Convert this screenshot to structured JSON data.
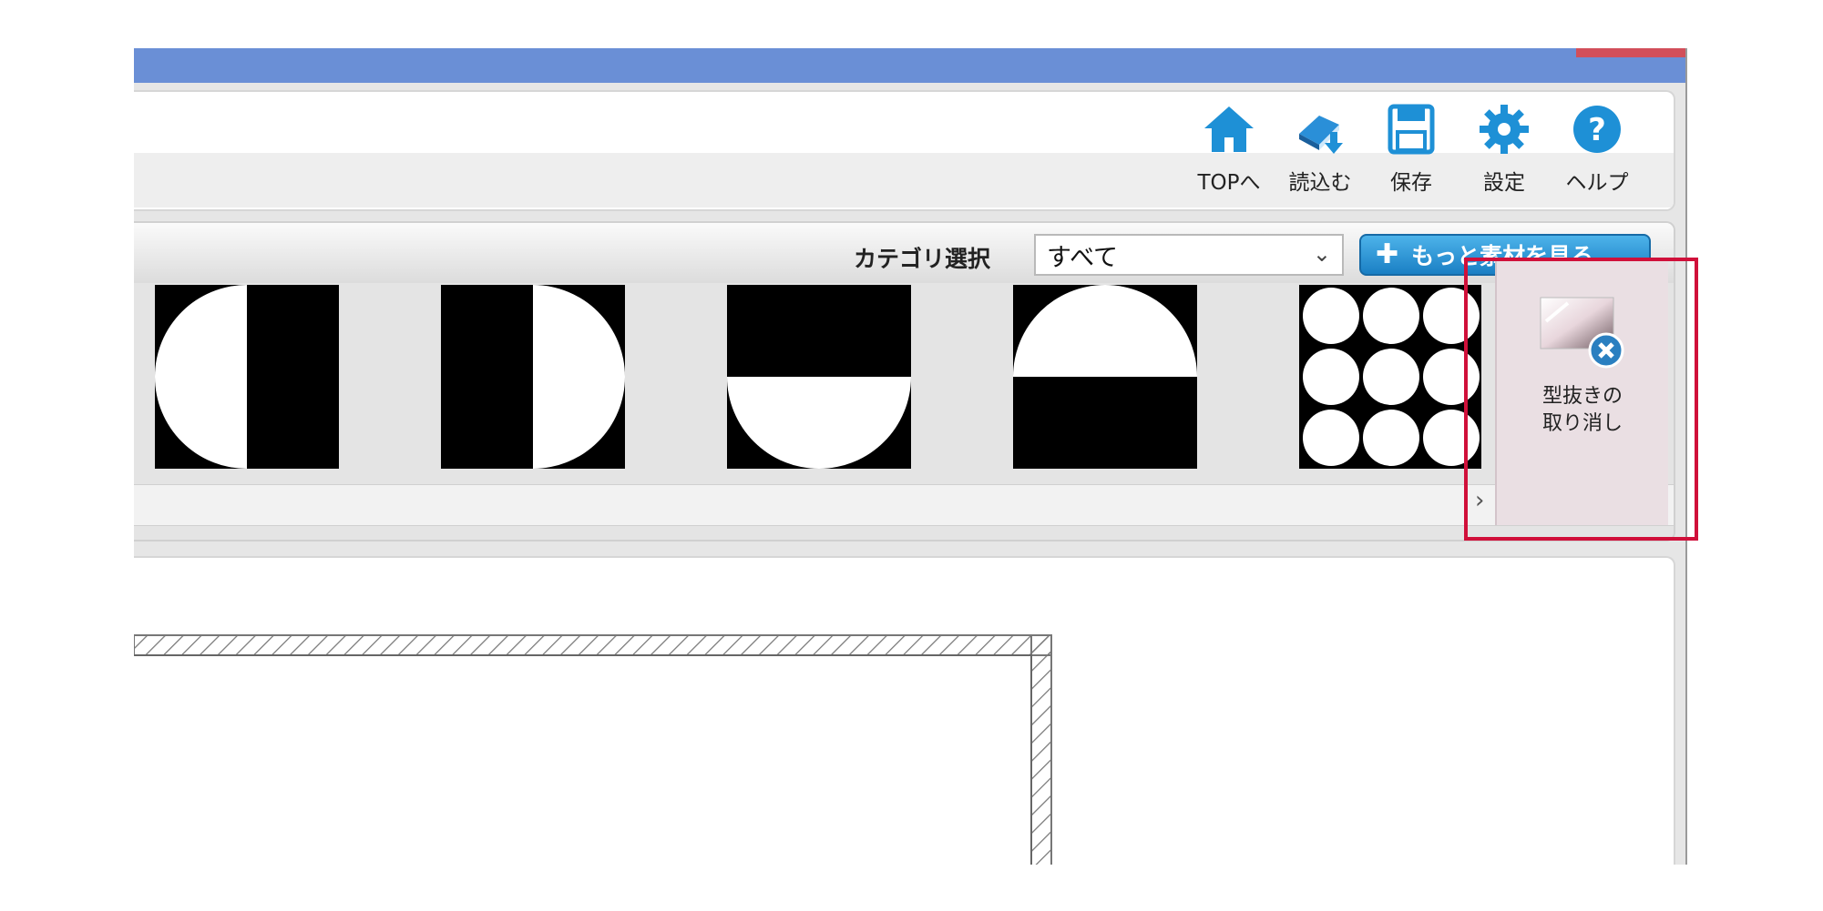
{
  "toolbar": {
    "items": [
      {
        "label": "TOPへ",
        "icon": "home-icon",
        "color": "#1e90d6"
      },
      {
        "label": "読込む",
        "icon": "book-download-icon",
        "color": "#1e90d6"
      },
      {
        "label": "保存",
        "icon": "floppy-disk-icon",
        "color": "#1e90d6"
      },
      {
        "label": "設定",
        "icon": "gear-icon",
        "color": "#1e90d6"
      },
      {
        "label": "ヘルプ",
        "icon": "help-icon",
        "color": "#1e90d6"
      }
    ]
  },
  "materials": {
    "category_label": "カテゴリ選択",
    "category_value": "すべて",
    "more_button_label": "もっと素材を見る",
    "thumbnails": [
      {
        "name": "left-half-circle-shape"
      },
      {
        "name": "right-half-circle-shape"
      },
      {
        "name": "bottom-half-circle-shape"
      },
      {
        "name": "top-half-circle-shape"
      },
      {
        "name": "circle-grid-shape"
      }
    ],
    "undo_cutout": {
      "line1": "型抜きの",
      "line2": "取り消し",
      "icon": "undo-cutout-icon"
    }
  },
  "colors": {
    "titlebar": "#6a8fd6",
    "accent_button": "#1a7fc4",
    "highlight": "#d0103a"
  }
}
